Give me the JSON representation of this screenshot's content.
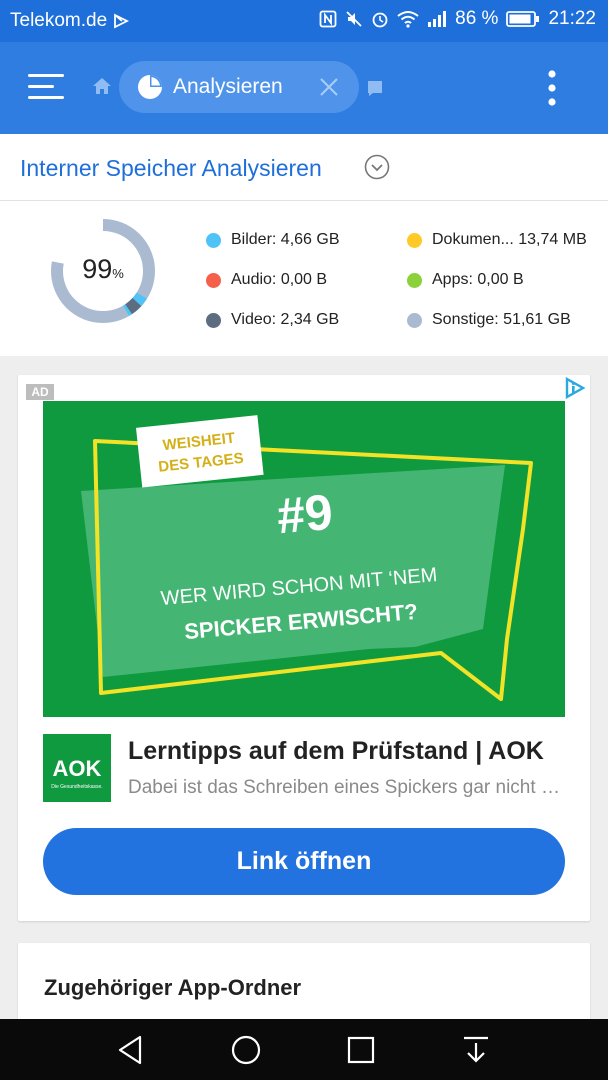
{
  "status_bar": {
    "carrier": "Telekom.de",
    "battery_percent": "86 %",
    "time": "21:22"
  },
  "toolbar": {
    "tab_label": "Analysieren"
  },
  "storage": {
    "title": "Interner Speicher Analysieren",
    "percent_value": "99",
    "percent_unit": "%",
    "legend": [
      {
        "label": "Bilder: 4,66 GB",
        "color": "#4fc3f7"
      },
      {
        "label": "Dokumen... 13,74 MB",
        "color": "#ffc928"
      },
      {
        "label": "Audio: 0,00 B",
        "color": "#f4604a"
      },
      {
        "label": "Apps: 0,00 B",
        "color": "#8bd13a"
      },
      {
        "label": "Video: 2,34 GB",
        "color": "#5c6d80"
      },
      {
        "label": "Sonstige: 51,61 GB",
        "color": "#a9bad1"
      }
    ]
  },
  "ad": {
    "badge": "AD",
    "banner_tag_line1": "WEISHEIT",
    "banner_tag_line2": "DES TAGES",
    "banner_number": "#9",
    "banner_line1": "WER WIRD SCHON MIT ‘NEM",
    "banner_line2": "SPICKER ERWISCHT?",
    "logo_text": "AOK",
    "logo_subtext": "Die Gesundheitskasse.",
    "headline": "Lerntipps auf dem Prüfstand | AOK",
    "description": "Dabei ist das Schreiben eines Spickers gar nicht so schlecht",
    "cta": "Link öffnen"
  },
  "related_folder": {
    "title": "Zugehöriger App-Ordner"
  },
  "colors": {
    "status_bar": "#1e6fd9",
    "app_bar": "#2f7de1",
    "accent": "#1e6fd9",
    "ad_green": "#0f9a3f",
    "cta_blue": "#2272e0"
  }
}
